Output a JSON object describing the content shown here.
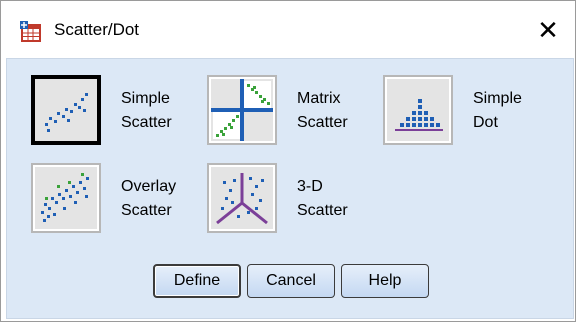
{
  "window": {
    "title": "Scatter/Dot",
    "close_glyph": "✕",
    "icon": "spreadsheet-chart-icon"
  },
  "options": [
    {
      "label_line1": "Simple",
      "label_line2": "Scatter",
      "icon": "simple-scatter-icon",
      "selected": true
    },
    {
      "label_line1": "Matrix",
      "label_line2": "Scatter",
      "icon": "matrix-scatter-icon",
      "selected": false
    },
    {
      "label_line1": "Simple",
      "label_line2": "Dot",
      "icon": "simple-dot-icon",
      "selected": false
    },
    {
      "label_line1": "Overlay",
      "label_line2": "Scatter",
      "icon": "overlay-scatter-icon",
      "selected": false
    },
    {
      "label_line1": "3-D",
      "label_line2": "Scatter",
      "icon": "3d-scatter-icon",
      "selected": false
    }
  ],
  "buttons": {
    "define": "Define",
    "cancel": "Cancel",
    "help": "Help"
  },
  "colors": {
    "panel_bg": "#dce8f6",
    "dot_blue": "#1f5fb5",
    "accent_green": "#3aa23a",
    "accent_purple": "#7b3f98"
  }
}
